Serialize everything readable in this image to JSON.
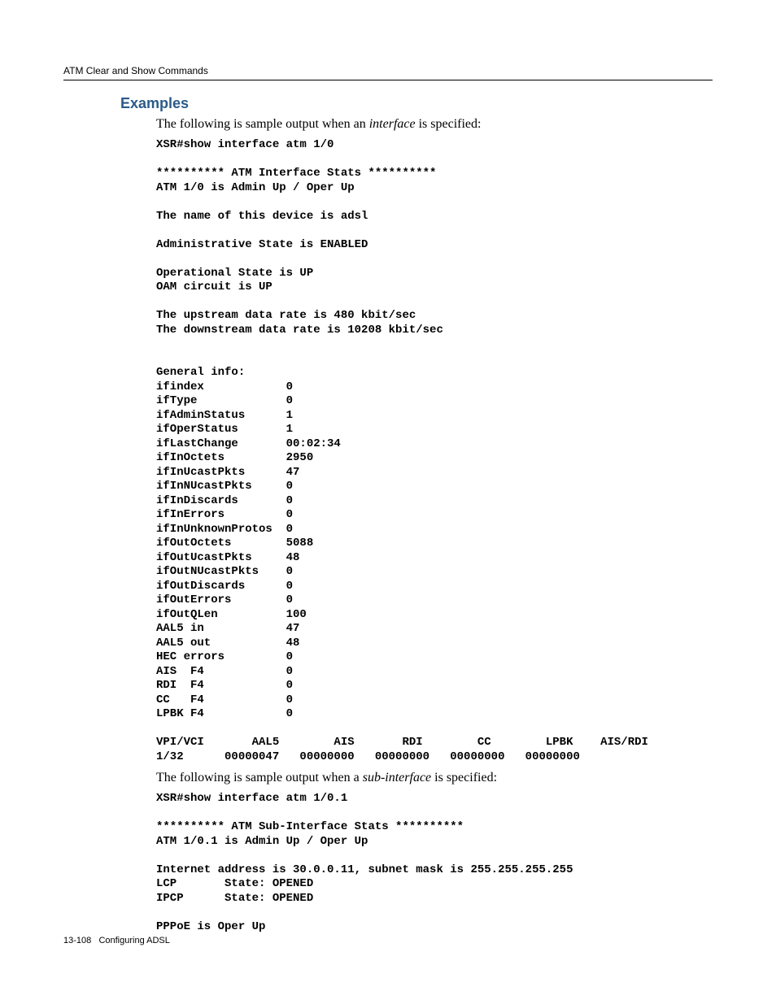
{
  "header": {
    "title": "ATM Clear and Show Commands"
  },
  "sectionTitle": "Examples",
  "intro1": {
    "pre": "The following is sample output when an ",
    "em": "interface",
    "post": " is specified:"
  },
  "cli1": {
    "cmd": "XSR#show interface atm 1/0",
    "blankA": "",
    "stars": "********** ATM Interface Stats **********",
    "status": "ATM 1/0 is Admin Up / Oper Up",
    "blankB": "",
    "device": "The name of this device is adsl",
    "blankC": "",
    "admin": "Administrative State is ENABLED",
    "blankD": "",
    "oper": "Operational State is UP",
    "oam": "OAM circuit is UP",
    "blankE": "",
    "up": "The upstream data rate is 480 kbit/sec",
    "down": "The downstream data rate is 10208 kbit/sec",
    "blankF": "",
    "blankG": "",
    "gen": "General info:",
    "l1": "ifindex            0",
    "l2": "ifType             0",
    "l3": "ifAdminStatus      1",
    "l4": "ifOperStatus       1",
    "l5": "ifLastChange       00:02:34",
    "l6": "ifInOctets         2950",
    "l7": "ifInUcastPkts      47",
    "l8": "ifInNUcastPkts     0",
    "l9": "ifInDiscards       0",
    "l10": "ifInErrors         0",
    "l11": "ifInUnknownProtos  0",
    "l12": "ifOutOctets        5088",
    "l13": "ifOutUcastPkts     48",
    "l14": "ifOutNUcastPkts    0",
    "l15": "ifOutDiscards      0",
    "l16": "ifOutErrors        0",
    "l17": "ifOutQLen          100",
    "l18": "AAL5 in            47",
    "l19": "AAL5 out           48",
    "l20": "HEC errors         0",
    "l21": "AIS  F4            0",
    "l22": "RDI  F4            0",
    "l23": "CC   F4            0",
    "l24": "LPBK F4            0",
    "blankH": "",
    "tblhdr": "VPI/VCI       AAL5        AIS       RDI        CC        LPBK    AIS/RDI",
    "tblrow": "1/32      00000047   00000000   00000000   00000000   00000000"
  },
  "intro2": {
    "pre": "The following is sample output when a ",
    "em": "sub-interface",
    "post": " is specified:"
  },
  "cli2": {
    "cmd": "XSR#show interface atm 1/0.1",
    "blankA": "",
    "stars": "********** ATM Sub-Interface Stats **********",
    "status": "ATM 1/0.1 is Admin Up / Oper Up",
    "blankB": "",
    "addr": "Internet address is 30.0.0.11, subnet mask is 255.255.255.255",
    "lcp": "LCP       State: OPENED",
    "ipcp": "IPCP      State: OPENED",
    "blankC": "",
    "pppoe": "PPPoE is Oper Up"
  },
  "footer": {
    "pageNum": "13-108",
    "chapter": "Configuring ADSL"
  }
}
